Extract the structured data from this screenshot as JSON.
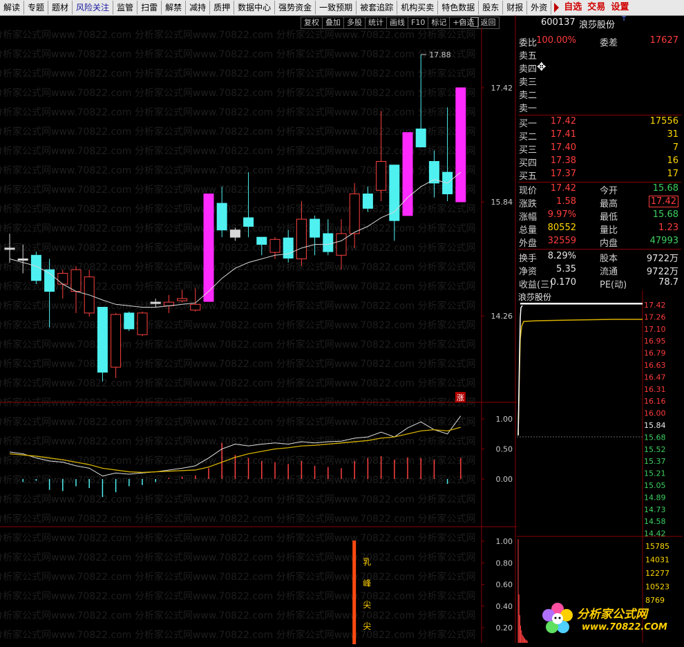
{
  "topbar": {
    "items": [
      "解读",
      "专题",
      "题材",
      "风险关注",
      "监管",
      "扫雷",
      "解禁",
      "减持",
      "质押",
      "数据中心",
      "强势资金",
      "一致预期",
      "被套追踪",
      "机构买卖",
      "特色数据",
      "股东",
      "财报",
      "外资"
    ],
    "active_item": "风险关注",
    "right_items": [
      "自选",
      "交易",
      "设置"
    ]
  },
  "chart_toolbar": [
    "复权",
    "叠加",
    "多股",
    "统计",
    "画线",
    "F10",
    "标记",
    "+自选",
    "返回"
  ],
  "watermark_text": "分析家公式网www.70822.com 分析家公式网www.70822.com 分析家公式网www.70822.com 分析家公式网",
  "chart_data": {
    "type": "candlestick",
    "price_axis_labels": [
      "17.42",
      "15.84",
      "14.26"
    ],
    "price_axis_values": [
      17.42,
      15.84,
      14.26
    ],
    "high_annotation": "17.88",
    "candles": [
      {
        "o": 15.2,
        "h": 15.4,
        "l": 15.0,
        "c": 15.2,
        "color": "white"
      },
      {
        "o": 15.05,
        "h": 15.25,
        "l": 14.85,
        "c": 15.05,
        "color": "white"
      },
      {
        "o": 15.1,
        "h": 15.15,
        "l": 14.7,
        "c": 14.75,
        "color": "cyan"
      },
      {
        "o": 14.9,
        "h": 15.05,
        "l": 14.1,
        "c": 14.6,
        "color": "cyan"
      },
      {
        "o": 14.7,
        "h": 14.9,
        "l": 14.5,
        "c": 14.85,
        "color": "red"
      },
      {
        "o": 14.6,
        "h": 14.95,
        "l": 14.3,
        "c": 14.9,
        "color": "red"
      },
      {
        "o": 14.8,
        "h": 14.9,
        "l": 14.25,
        "c": 14.3,
        "color": "red"
      },
      {
        "o": 14.38,
        "h": 14.38,
        "l": 13.35,
        "c": 13.48,
        "color": "cyan"
      },
      {
        "o": 13.55,
        "h": 14.3,
        "l": 13.4,
        "c": 14.28,
        "color": "red"
      },
      {
        "o": 14.3,
        "h": 14.32,
        "l": 14.05,
        "c": 14.08,
        "color": "cyan"
      },
      {
        "o": 14.0,
        "h": 14.32,
        "l": 13.98,
        "c": 14.3,
        "color": "red"
      },
      {
        "o": 14.44,
        "h": 14.5,
        "l": 14.38,
        "c": 14.45,
        "color": "white"
      },
      {
        "o": 14.4,
        "h": 14.55,
        "l": 14.3,
        "c": 14.45,
        "color": "red"
      },
      {
        "o": 14.47,
        "h": 14.62,
        "l": 14.45,
        "c": 14.5,
        "color": "red"
      },
      {
        "o": 14.34,
        "h": 14.64,
        "l": 14.32,
        "c": 14.42,
        "color": "red"
      },
      {
        "o": 14.46,
        "h": 15.95,
        "l": 14.46,
        "c": 15.95,
        "color": "magenta"
      },
      {
        "o": 15.82,
        "h": 16.05,
        "l": 15.35,
        "c": 15.45,
        "color": "cyan"
      },
      {
        "o": 15.45,
        "h": 15.48,
        "l": 15.3,
        "c": 15.35,
        "color": "white"
      },
      {
        "o": 15.62,
        "h": 16.25,
        "l": 15.35,
        "c": 15.5,
        "color": "cyan"
      },
      {
        "o": 15.25,
        "h": 15.35,
        "l": 15.1,
        "c": 15.35,
        "color": "cyan"
      },
      {
        "o": 15.14,
        "h": 15.35,
        "l": 15.05,
        "c": 15.32,
        "color": "red"
      },
      {
        "o": 15.34,
        "h": 15.45,
        "l": 15.0,
        "c": 15.06,
        "color": "cyan"
      },
      {
        "o": 15.05,
        "h": 15.85,
        "l": 14.95,
        "c": 15.6,
        "color": "red"
      },
      {
        "o": 15.6,
        "h": 15.65,
        "l": 15.1,
        "c": 15.35,
        "color": "cyan"
      },
      {
        "o": 15.4,
        "h": 15.6,
        "l": 15.1,
        "c": 15.15,
        "color": "cyan"
      },
      {
        "o": 15.1,
        "h": 15.6,
        "l": 14.9,
        "c": 15.4,
        "color": "red"
      },
      {
        "o": 15.4,
        "h": 16.1,
        "l": 15.2,
        "c": 15.95,
        "color": "red"
      },
      {
        "o": 15.95,
        "h": 16.05,
        "l": 15.7,
        "c": 15.75,
        "color": "cyan"
      },
      {
        "o": 16.0,
        "h": 17.1,
        "l": 15.85,
        "c": 16.4,
        "color": "red"
      },
      {
        "o": 16.35,
        "h": 16.35,
        "l": 15.3,
        "c": 15.58,
        "color": "cyan"
      },
      {
        "o": 15.65,
        "h": 16.8,
        "l": 15.65,
        "c": 16.8,
        "color": "magenta"
      },
      {
        "o": 16.85,
        "h": 17.88,
        "l": 16.6,
        "c": 16.6,
        "color": "cyan"
      },
      {
        "o": 16.4,
        "h": 16.55,
        "l": 15.9,
        "c": 16.1,
        "color": "cyan"
      },
      {
        "o": 16.25,
        "h": 17.15,
        "l": 15.85,
        "c": 15.95,
        "color": "cyan"
      },
      {
        "o": 15.84,
        "h": 17.42,
        "l": 15.84,
        "c": 17.42,
        "color": "magenta"
      }
    ],
    "ma_line": [
      15.05,
      15.0,
      14.95,
      14.85,
      14.7,
      14.6,
      14.55,
      14.48,
      14.42,
      14.4,
      14.38,
      14.38,
      14.4,
      14.42,
      14.44,
      14.6,
      14.78,
      14.92,
      15.0,
      15.05,
      15.1,
      15.12,
      15.2,
      15.25,
      15.25,
      15.3,
      15.42,
      15.5,
      15.62,
      15.7,
      15.9,
      16.05,
      16.15,
      16.1,
      16.25
    ],
    "indicator_axis_labels": [
      "1.00",
      "0.50",
      "0.00"
    ],
    "indicator_axis_values": [
      1.0,
      0.5,
      0.0
    ],
    "indicator_white": [
      0.45,
      0.42,
      0.35,
      0.3,
      0.28,
      0.22,
      0.18,
      0.05,
      0.1,
      0.08,
      0.1,
      0.12,
      0.15,
      0.18,
      0.22,
      0.35,
      0.5,
      0.58,
      0.55,
      0.58,
      0.6,
      0.58,
      0.62,
      0.6,
      0.62,
      0.63,
      0.68,
      0.7,
      0.78,
      0.7,
      0.85,
      0.95,
      0.82,
      0.75,
      1.05
    ],
    "indicator_yellow": [
      0.42,
      0.4,
      0.38,
      0.35,
      0.32,
      0.28,
      0.24,
      0.18,
      0.15,
      0.12,
      0.11,
      0.12,
      0.13,
      0.14,
      0.15,
      0.2,
      0.28,
      0.36,
      0.42,
      0.46,
      0.5,
      0.52,
      0.55,
      0.56,
      0.58,
      0.6,
      0.62,
      0.64,
      0.68,
      0.7,
      0.75,
      0.8,
      0.82,
      0.8,
      0.86
    ],
    "indicator_bars": [
      0.0,
      -0.05,
      -0.03,
      -0.18,
      -0.2,
      -0.12,
      -0.15,
      -0.3,
      -0.22,
      -0.12,
      -0.1,
      -0.05,
      0.02,
      0.04,
      0.06,
      0.18,
      0.6,
      0.4,
      0.35,
      0.3,
      0.28,
      0.25,
      0.3,
      0.22,
      0.2,
      0.18,
      0.3,
      0.35,
      0.38,
      0.32,
      0.36,
      0.35,
      0.32,
      -0.08,
      0.35
    ],
    "rise_marker": "涨",
    "bottom_axis_labels": [
      "1.00",
      "0.80",
      "0.60",
      "0.40",
      "0.20"
    ],
    "bottom_axis_values": [
      1.0,
      0.8,
      0.6,
      0.4,
      0.2
    ],
    "bottom_signal_index": 26,
    "bottom_signal_texts": [
      "乳",
      "峰",
      "尖",
      "尖"
    ]
  },
  "quote": {
    "code": "600137",
    "name": "浪莎股份",
    "name_suffix": "T",
    "weibi_label": "委比",
    "weibi_value": "100.00%",
    "weicha_label": "委差",
    "weicha_value": "17627",
    "sell": [
      {
        "label": "卖五",
        "price": "",
        "vol": ""
      },
      {
        "label": "卖四",
        "price": "",
        "vol": ""
      },
      {
        "label": "卖三",
        "price": "",
        "vol": ""
      },
      {
        "label": "卖二",
        "price": "",
        "vol": ""
      },
      {
        "label": "卖一",
        "price": "",
        "vol": ""
      }
    ],
    "buy": [
      {
        "label": "买一",
        "price": "17.42",
        "vol": "17556"
      },
      {
        "label": "买二",
        "price": "17.41",
        "vol": "31"
      },
      {
        "label": "买三",
        "price": "17.40",
        "vol": "7"
      },
      {
        "label": "买四",
        "price": "17.38",
        "vol": "16"
      },
      {
        "label": "买五",
        "price": "17.37",
        "vol": "17"
      }
    ],
    "stats": [
      {
        "l1": "现价",
        "v1": "17.42",
        "c1": "red",
        "l2": "今开",
        "v2": "15.68",
        "c2": "green"
      },
      {
        "l1": "涨跌",
        "v1": "1.58",
        "c1": "red",
        "l2": "最高",
        "v2": "17.42",
        "c2": "red",
        "boxed": true
      },
      {
        "l1": "涨幅",
        "v1": "9.97%",
        "c1": "red",
        "l2": "最低",
        "v2": "15.68",
        "c2": "green"
      },
      {
        "l1": "总量",
        "v1": "80552",
        "c1": "yellow",
        "l2": "量比",
        "v2": "1.23",
        "c2": "red"
      },
      {
        "l1": "外盘",
        "v1": "32559",
        "c1": "red",
        "l2": "内盘",
        "v2": "47993",
        "c2": "green"
      }
    ],
    "stats2": [
      {
        "l1": "换手",
        "v1": "8.29%",
        "l2": "股本",
        "v2": "9722万"
      },
      {
        "l1": "净资",
        "v1": "5.35",
        "l2": "流通",
        "v2": "9722万"
      },
      {
        "l1": "收益(三)",
        "v1": "0.170",
        "l2": "PE(动)",
        "v2": "78.7"
      }
    ]
  },
  "mini_chart": {
    "title": "浪莎股份",
    "price_labels": [
      {
        "t": "17.42",
        "c": "red"
      },
      {
        "t": "17.26",
        "c": "red"
      },
      {
        "t": "17.10",
        "c": "red"
      },
      {
        "t": "16.95",
        "c": "red"
      },
      {
        "t": "16.79",
        "c": "red"
      },
      {
        "t": "16.63",
        "c": "red"
      },
      {
        "t": "16.47",
        "c": "red"
      },
      {
        "t": "16.31",
        "c": "red"
      },
      {
        "t": "16.16",
        "c": "red"
      },
      {
        "t": "16.00",
        "c": "red"
      },
      {
        "t": "15.84",
        "c": "white"
      },
      {
        "t": "15.68",
        "c": "green"
      },
      {
        "t": "15.52",
        "c": "green"
      },
      {
        "t": "15.37",
        "c": "green"
      },
      {
        "t": "15.21",
        "c": "green"
      },
      {
        "t": "15.05",
        "c": "green"
      },
      {
        "t": "14.89",
        "c": "green"
      },
      {
        "t": "14.73",
        "c": "green"
      },
      {
        "t": "14.58",
        "c": "green"
      },
      {
        "t": "14.42",
        "c": "green"
      }
    ],
    "volume_labels": [
      "15785",
      "14031",
      "12277",
      "10523",
      "8769"
    ]
  },
  "logo": {
    "title": "分析家公式网",
    "url": "www.70822.COM"
  }
}
